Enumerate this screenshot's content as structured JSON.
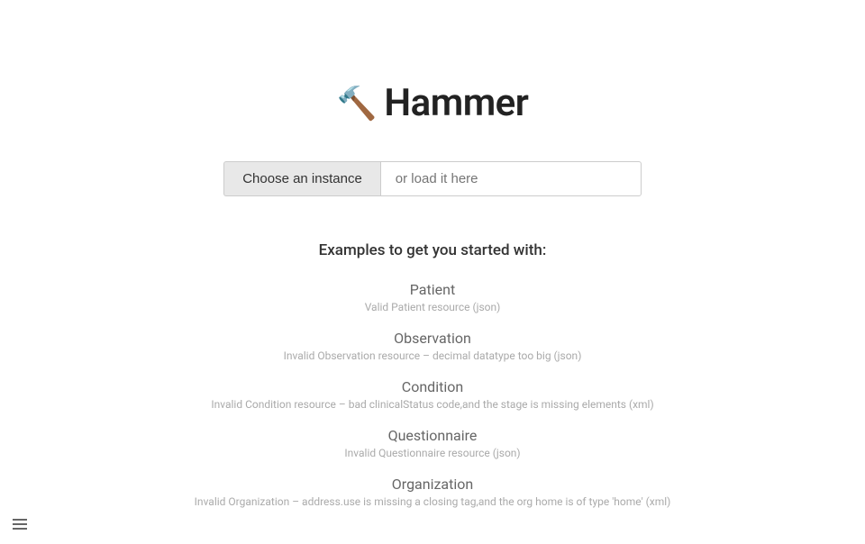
{
  "header": {
    "icon": "🔨",
    "title": "Hammer"
  },
  "toolbar": {
    "choose_instance_label": "Choose an instance",
    "load_placeholder": "or load it here"
  },
  "examples": {
    "section_title": "Examples to get you started with:",
    "items": [
      {
        "name": "Patient",
        "description": "Valid Patient resource (json)"
      },
      {
        "name": "Observation",
        "description": "Invalid Observation resource – decimal datatype too big (json)"
      },
      {
        "name": "Condition",
        "description": "Invalid Condition resource – bad clinicalStatus code,and the stage is missing elements (xml)"
      },
      {
        "name": "Questionnaire",
        "description": "Invalid Questionnaire resource (json)"
      },
      {
        "name": "Organization",
        "description": "Invalid Organization – address.use is missing a closing tag,and the org home is of type 'home' (xml)"
      }
    ]
  }
}
